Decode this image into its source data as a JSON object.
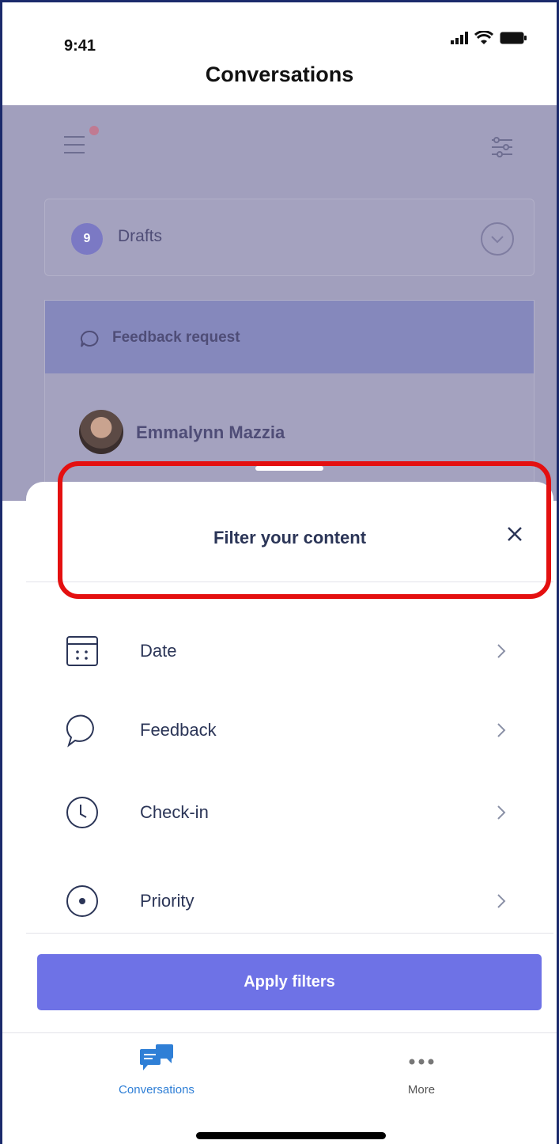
{
  "status_bar": {
    "time": "9:41"
  },
  "header": {
    "title": "Conversations"
  },
  "background": {
    "drafts": {
      "count": "9",
      "label": "Drafts"
    },
    "feedback_card": {
      "label": "Feedback request",
      "person": "Emmalynn Mazzia"
    }
  },
  "sheet": {
    "title": "Filter your content",
    "items": [
      {
        "label": "Date",
        "icon": "calendar-icon"
      },
      {
        "label": "Feedback",
        "icon": "speech-bubble-icon"
      },
      {
        "label": "Check-in",
        "icon": "clock-icon"
      },
      {
        "label": "Priority",
        "icon": "target-dot-icon"
      }
    ],
    "apply_label": "Apply filters"
  },
  "tabbar": {
    "tabs": [
      {
        "label": "Conversations",
        "icon": "chat-bubbles-icon",
        "active": true
      },
      {
        "label": "More",
        "icon": "more-dots-icon",
        "active": false
      }
    ]
  },
  "colors": {
    "accent": "#6e72e6",
    "active_tab": "#2f7fd6",
    "highlight_border": "#e41010",
    "overlay": "#a19fbd"
  }
}
